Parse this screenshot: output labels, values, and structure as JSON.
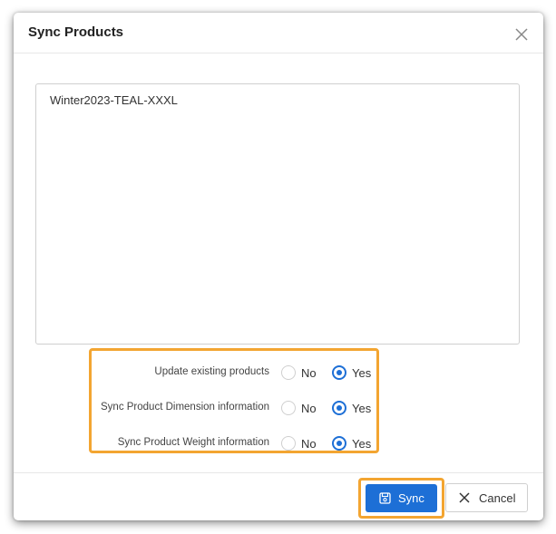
{
  "dialog": {
    "title": "Sync Products",
    "close_icon": "close-icon"
  },
  "products_textarea": {
    "value": "Winter2023-TEAL-XXXL"
  },
  "options": [
    {
      "label": "Update existing products",
      "no_label": "No",
      "yes_label": "Yes",
      "selected": "Yes"
    },
    {
      "label": "Sync Product Dimension information",
      "no_label": "No",
      "yes_label": "Yes",
      "selected": "Yes"
    },
    {
      "label": "Sync Product Weight information",
      "no_label": "No",
      "yes_label": "Yes",
      "selected": "Yes"
    }
  ],
  "footer": {
    "sync_label": "Sync",
    "sync_icon": "save-icon",
    "cancel_label": "Cancel",
    "cancel_icon": "close-icon"
  },
  "colors": {
    "primary": "#1d6fd6",
    "highlight": "#f3a531"
  }
}
